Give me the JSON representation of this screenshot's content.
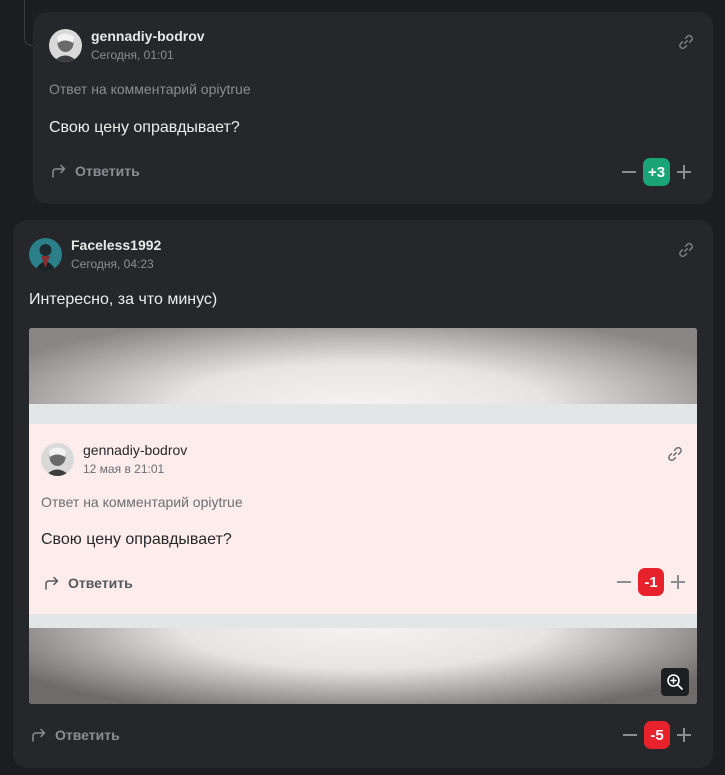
{
  "comment_1": {
    "username": "gennadiy-bodrov",
    "date": "Сегодня, 01:01",
    "reply_note": "Ответ на комментарий opiytrue",
    "text": "Свою цену оправдывает?",
    "reply_label": "Ответить",
    "score": "+3",
    "score_color": "#1aa374"
  },
  "comment_2": {
    "username": "Faceless1992",
    "date": "Сегодня, 04:23",
    "text": "Интересно, за что минус)",
    "reply_label": "Ответить",
    "score": "-5",
    "score_color": "#e8222c",
    "attachment": {
      "username": "gennadiy-bodrov",
      "date": "12 мая в 21:01",
      "reply_note": "Ответ на комментарий opiytrue",
      "text": "Свою цену оправдывает?",
      "reply_label": "Ответить",
      "score": "-1",
      "score_color": "#e8222c"
    }
  },
  "icons": {
    "link": "link-icon",
    "reply": "reply-arrow-icon",
    "zoom": "zoom-in-icon",
    "minus": "minus-icon",
    "plus": "plus-icon"
  }
}
